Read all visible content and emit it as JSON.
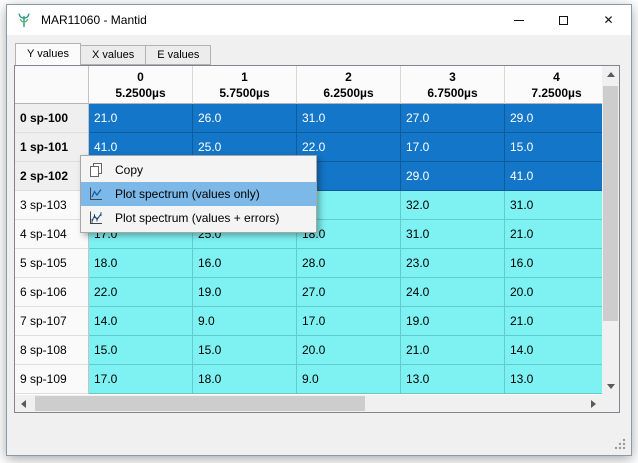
{
  "window": {
    "title": "MAR11060 - Mantid"
  },
  "tabs": [
    {
      "label": "Y values",
      "active": true
    },
    {
      "label": "X values",
      "active": false
    },
    {
      "label": "E values",
      "active": false
    }
  ],
  "table": {
    "columns": [
      {
        "index": "0",
        "time": "5.2500µs"
      },
      {
        "index": "1",
        "time": "5.7500µs"
      },
      {
        "index": "2",
        "time": "6.2500µs"
      },
      {
        "index": "3",
        "time": "6.7500µs"
      },
      {
        "index": "4",
        "time": "7.2500µs"
      }
    ],
    "rows": [
      {
        "header": "0 sp-100",
        "selected": true,
        "values": [
          "21.0",
          "26.0",
          "31.0",
          "27.0",
          "29.0"
        ]
      },
      {
        "header": "1 sp-101",
        "selected": true,
        "values": [
          "41.0",
          "25.0",
          "22.0",
          "17.0",
          "15.0"
        ]
      },
      {
        "header": "2 sp-102",
        "selected": true,
        "values": [
          "",
          "",
          "",
          "29.0",
          "41.0"
        ]
      },
      {
        "header": "3 sp-103",
        "selected": false,
        "values": [
          "",
          "",
          "",
          "32.0",
          "31.0"
        ]
      },
      {
        "header": "4 sp-104",
        "selected": false,
        "values": [
          "17.0",
          "25.0",
          "18.0",
          "31.0",
          "21.0"
        ]
      },
      {
        "header": "5 sp-105",
        "selected": false,
        "values": [
          "18.0",
          "16.0",
          "28.0",
          "23.0",
          "16.0"
        ]
      },
      {
        "header": "6 sp-106",
        "selected": false,
        "values": [
          "22.0",
          "19.0",
          "27.0",
          "24.0",
          "20.0"
        ]
      },
      {
        "header": "7 sp-107",
        "selected": false,
        "values": [
          "14.0",
          "9.0",
          "17.0",
          "19.0",
          "21.0"
        ]
      },
      {
        "header": "8 sp-108",
        "selected": false,
        "values": [
          "15.0",
          "15.0",
          "20.0",
          "21.0",
          "14.0"
        ]
      },
      {
        "header": "9 sp-109",
        "selected": false,
        "values": [
          "17.0",
          "18.0",
          "9.0",
          "13.0",
          "13.0"
        ]
      }
    ]
  },
  "context_menu": {
    "items": [
      {
        "label": "Copy",
        "icon": "copy-icon",
        "highlighted": false
      },
      {
        "label": "Plot spectrum (values only)",
        "icon": "plot-spectrum-icon",
        "highlighted": true
      },
      {
        "label": "Plot spectrum (values + errors)",
        "icon": "plot-spectrum-errors-icon",
        "highlighted": false
      }
    ]
  },
  "colors": {
    "selection_blue": "#1476c8",
    "cell_cyan": "#7ef2f2",
    "menu_highlight": "#7db9e8",
    "titlebar_bg": "#ffffff",
    "window_bg": "#f0f0f0"
  }
}
